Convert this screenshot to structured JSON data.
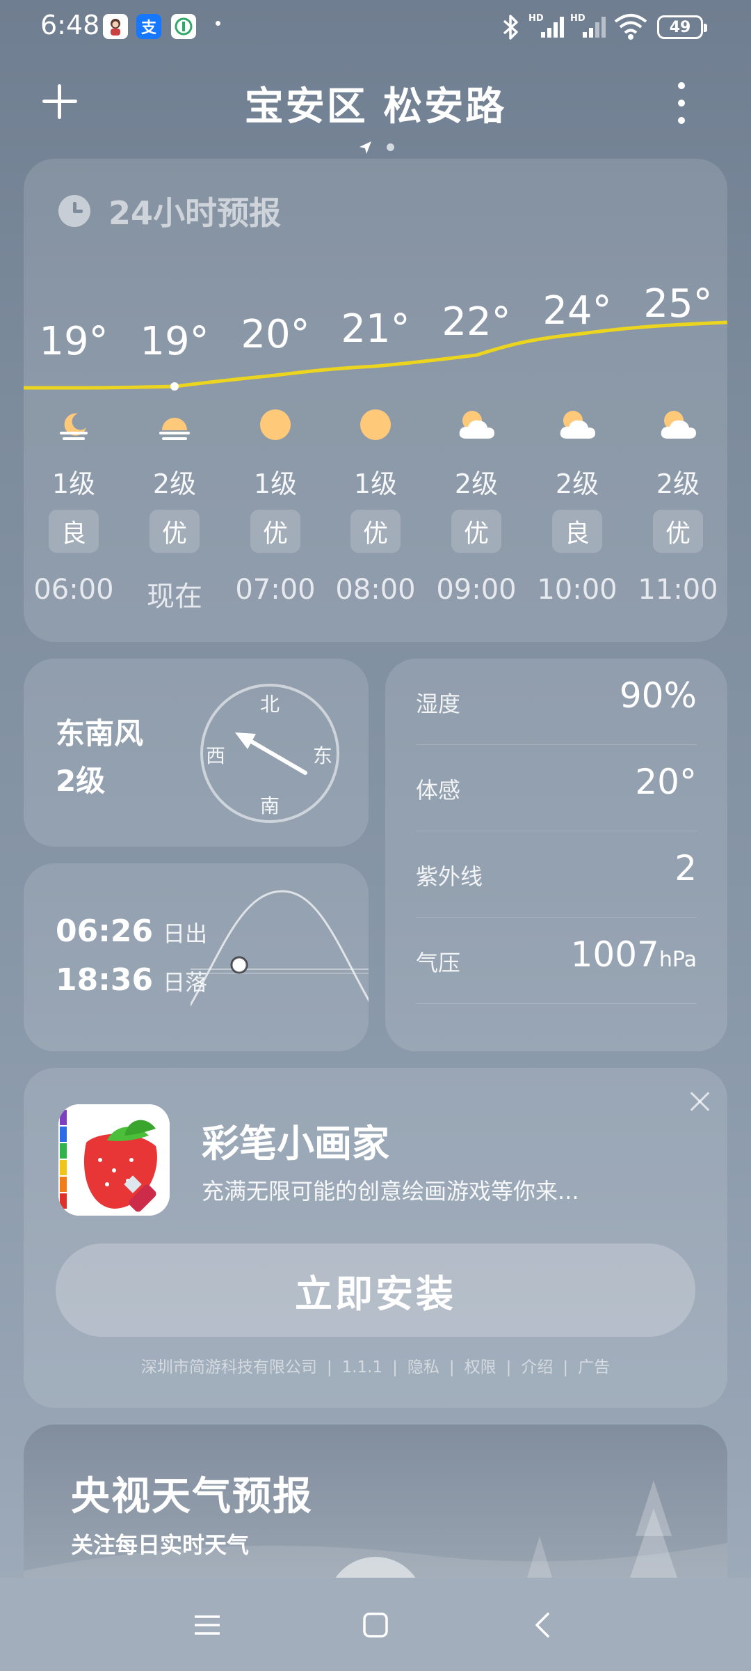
{
  "status_bar": {
    "time": "6:48",
    "battery": "49",
    "icons": [
      "avatar-icon",
      "alipay-icon",
      "app-icon",
      "bluetooth-icon",
      "hd-signal-icon",
      "hd-signal-icon",
      "wifi-icon",
      "battery-icon"
    ]
  },
  "header": {
    "location": "宝安区 松安路"
  },
  "forecast": {
    "title": "24小时预报",
    "hours": [
      {
        "temp": "19°",
        "icon": "moon-cloud-icon",
        "wind": "1级",
        "aqi": "良",
        "time": "06:00"
      },
      {
        "temp": "19°",
        "icon": "sunrise-icon",
        "wind": "2级",
        "aqi": "优",
        "time": "现在"
      },
      {
        "temp": "20°",
        "icon": "sun-icon",
        "wind": "1级",
        "aqi": "优",
        "time": "07:00"
      },
      {
        "temp": "21°",
        "icon": "sun-icon",
        "wind": "1级",
        "aqi": "优",
        "time": "08:00"
      },
      {
        "temp": "22°",
        "icon": "partly-cloudy-icon",
        "wind": "2级",
        "aqi": "优",
        "time": "09:00"
      },
      {
        "temp": "24°",
        "icon": "partly-cloudy-icon",
        "wind": "2级",
        "aqi": "良",
        "time": "10:00"
      },
      {
        "temp": "25°",
        "icon": "partly-cloudy-icon",
        "wind": "2级",
        "aqi": "优",
        "time": "11:00"
      }
    ]
  },
  "wind": {
    "direction": "东南风",
    "level": "2级",
    "compass": {
      "north": "北",
      "south": "南",
      "east": "东",
      "west": "西"
    }
  },
  "sun": {
    "sunrise_time": "06:26",
    "sunrise_label": "日出",
    "sunset_time": "18:36",
    "sunset_label": "日落"
  },
  "details": {
    "humidity_label": "湿度",
    "humidity_value": "90%",
    "feels_like_label": "体感",
    "feels_like_value": "20°",
    "uv_label": "紫外线",
    "uv_value": "2",
    "pressure_label": "气压",
    "pressure_value": "1007",
    "pressure_unit": "hPa"
  },
  "ad": {
    "title": "彩笔小画家",
    "description": "充满无限可能的创意绘画游戏等你来...",
    "install_label": "立即安装",
    "footer": {
      "company": "深圳市简游科技有限公司",
      "version": "1.1.1",
      "privacy": "隐私",
      "permissions": "权限",
      "intro": "介绍",
      "ad_tag": "广告"
    }
  },
  "cctv": {
    "title": "央视天气预报",
    "subtitle": "关注每日实时天气"
  },
  "colors": {
    "temp_line": "#f0d020",
    "sun_icon": "#ffc97a"
  }
}
